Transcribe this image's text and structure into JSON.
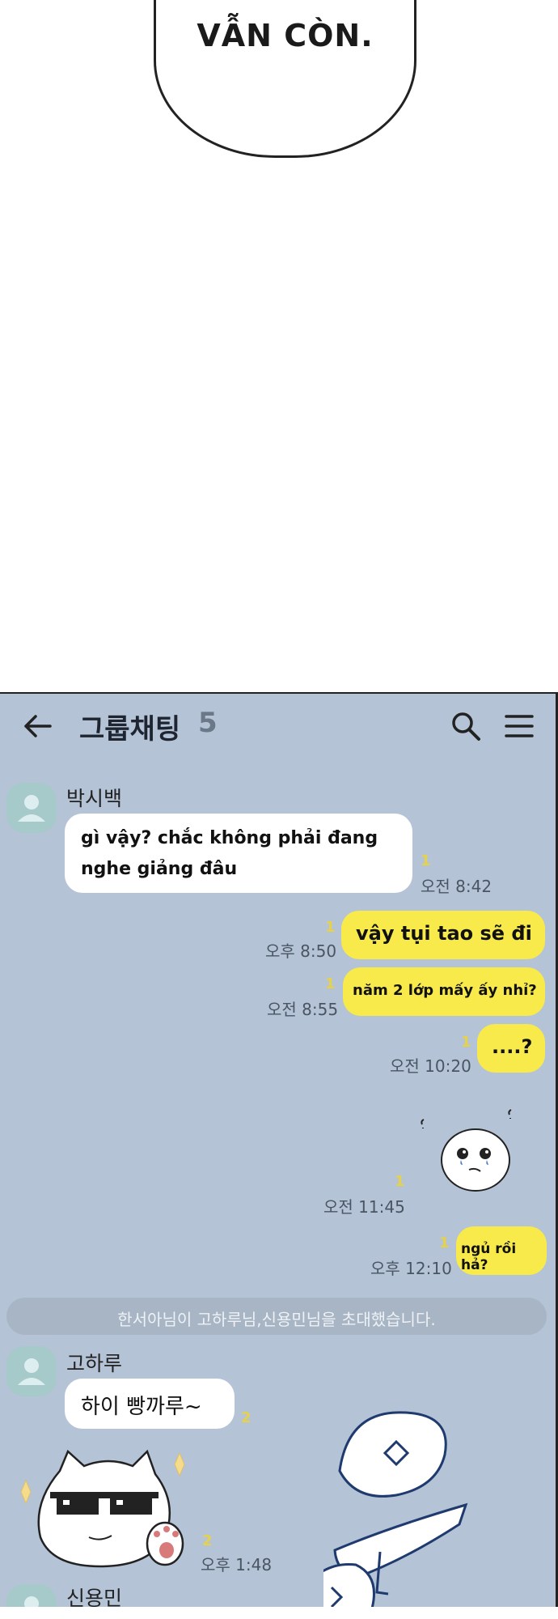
{
  "comic": {
    "speech": "VẪN CÒN."
  },
  "chat": {
    "title": "그룹채팅",
    "member_count": "5",
    "icons": {
      "back": "back-arrow-icon",
      "search": "search-icon",
      "menu": "hamburger-menu-icon"
    },
    "messages": [
      {
        "sender": "박시백",
        "line1": "gì vậy? chắc không phải đang",
        "line2": "nghe giảng đâu",
        "unread": "1",
        "time": "오전 8:42"
      },
      {
        "text": "vậy tụi tao sẽ đi",
        "unread": "1",
        "time": "오후 8:50"
      },
      {
        "text": "năm 2 lớp mấy ấy nhỉ?",
        "unread": "1",
        "time": "오전 8:55"
      },
      {
        "text": "....?",
        "unread": "1",
        "time": "오전 10:20"
      },
      {
        "sticker": "crying-blob-sticker",
        "unread": "1",
        "time": "오전 11:45"
      },
      {
        "text": "ngủ rồi hả?",
        "unread": "1",
        "time": "오후 12:10"
      },
      {
        "sender": "고하루",
        "text": "하이 빵까루~",
        "unread": "2"
      },
      {
        "sticker": "sunglasses-cat-sticker",
        "unread": "2",
        "time": "오후 1:48"
      }
    ],
    "system_notice": "한서아님이 고하루님,신용민님을 초대했습니다.",
    "next_sender": "신용민"
  }
}
